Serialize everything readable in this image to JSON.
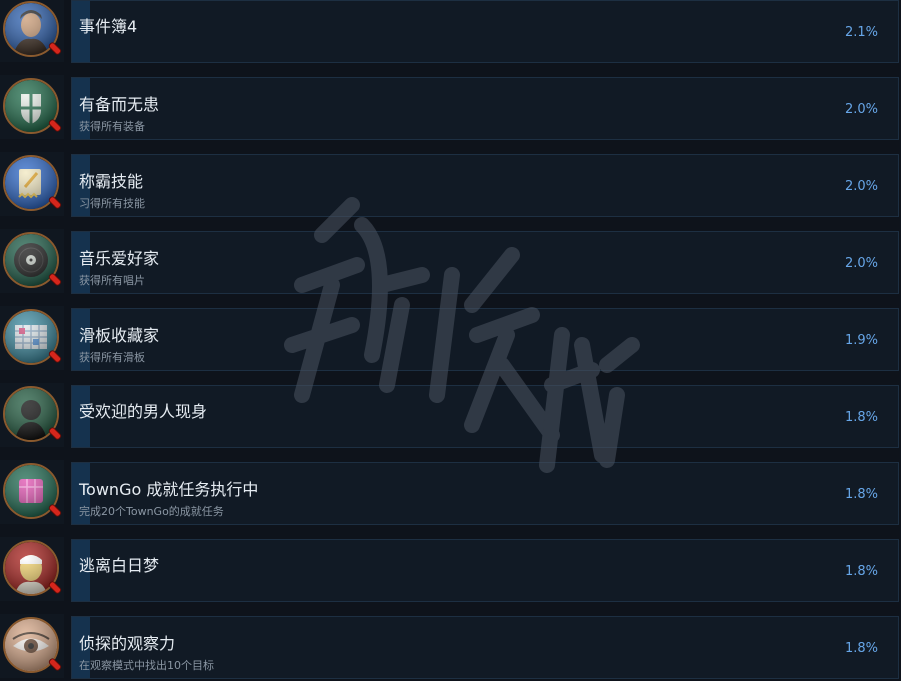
{
  "colors": {
    "background": "#0e131b",
    "card": "#111a25",
    "progress_fill": "#15324e",
    "percent_text": "#67a6e8",
    "title_text": "#e6ecf2",
    "desc_text": "#8a96a3"
  },
  "achievements": [
    {
      "title": "事件簿4",
      "description": "",
      "percent": "2.1%",
      "icon": "portrait-man-icon",
      "badge_color": "#2a5fb0",
      "progress": 0.021
    },
    {
      "title": "有备而无患",
      "description": "获得所有装备",
      "percent": "2.0%",
      "icon": "shield-icon",
      "badge_color": "#1c6a48",
      "progress": 0.02
    },
    {
      "title": "称霸技能",
      "description": "习得所有技能",
      "percent": "2.0%",
      "icon": "skill-book-icon",
      "badge_color": "#2a66c8",
      "progress": 0.02
    },
    {
      "title": "音乐爱好家",
      "description": "获得所有唱片",
      "percent": "2.0%",
      "icon": "vinyl-record-icon",
      "badge_color": "#1c5e48",
      "progress": 0.02
    },
    {
      "title": "滑板收藏家",
      "description": "获得所有滑板",
      "percent": "1.9%",
      "icon": "skateboard-icon",
      "badge_color": "#3a8aa0",
      "progress": 0.019
    },
    {
      "title": "受欢迎的男人现身",
      "description": "",
      "percent": "1.8%",
      "icon": "silhouette-icon",
      "badge_color": "#1f5a3e",
      "progress": 0.018
    },
    {
      "title": "TownGo 成就任务执行中",
      "description": "完成20个TownGo的成就任务",
      "percent": "1.8%",
      "icon": "pink-box-icon",
      "badge_color": "#1d6a50",
      "progress": 0.018
    },
    {
      "title": "逃离白日梦",
      "description": "",
      "percent": "1.8%",
      "icon": "blank-face-icon",
      "badge_color": "#a81e1a",
      "progress": 0.018
    },
    {
      "title": "侦探的观察力",
      "description": "在观察模式中找出10个目标",
      "percent": "1.8%",
      "icon": "eye-icon",
      "badge_color": "#c08a6a",
      "progress": 0.018
    }
  ]
}
